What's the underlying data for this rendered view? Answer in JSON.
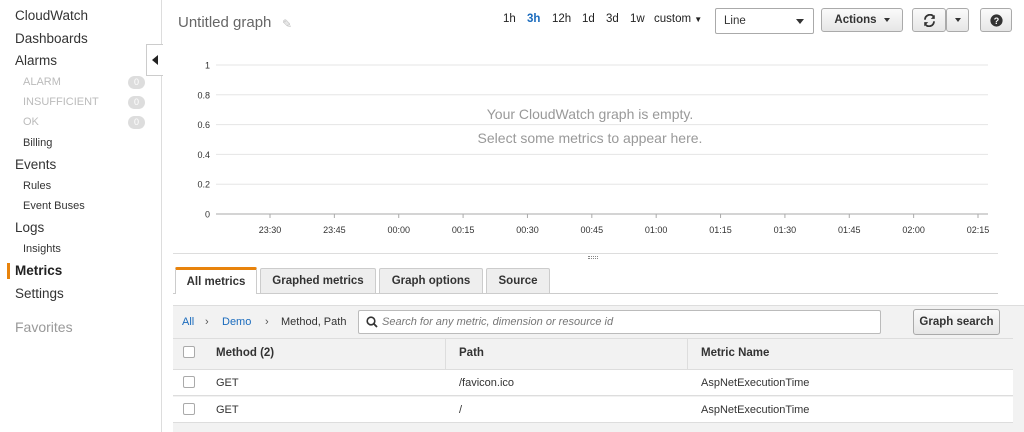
{
  "sidebar": {
    "items": [
      {
        "label": "CloudWatch"
      },
      {
        "label": "Dashboards"
      },
      {
        "label": "Alarms"
      },
      {
        "label": "ALARM",
        "badge": "0"
      },
      {
        "label": "INSUFFICIENT",
        "badge": "0"
      },
      {
        "label": "OK",
        "badge": "0"
      },
      {
        "label": "Billing"
      },
      {
        "label": "Events"
      },
      {
        "label": "Rules"
      },
      {
        "label": "Event Buses"
      },
      {
        "label": "Logs"
      },
      {
        "label": "Insights"
      },
      {
        "label": "Metrics"
      },
      {
        "label": "Settings"
      }
    ],
    "favorites": "Favorites",
    "active_item": "Metrics"
  },
  "header": {
    "title": "Untitled graph",
    "time_ranges": [
      "1h",
      "3h",
      "12h",
      "1d",
      "3d",
      "1w",
      "custom"
    ],
    "active_range": "3h",
    "chart_type_select": "Line",
    "actions_label": "Actions"
  },
  "chart_data": {
    "type": "line",
    "x_tick_labels": [
      "23:30",
      "23:45",
      "00:00",
      "00:15",
      "00:30",
      "00:45",
      "01:00",
      "01:15",
      "01:30",
      "01:45",
      "02:00",
      "02:15"
    ],
    "y_tick_labels": [
      "1",
      "0.8",
      "0.6",
      "0.4",
      "0.2",
      "0"
    ],
    "ylim": [
      0,
      1
    ],
    "series": [],
    "grid": true
  },
  "empty_message": {
    "line1": "Your CloudWatch graph is empty.",
    "line2": "Select some metrics to appear here."
  },
  "tabs": [
    {
      "label": "All metrics"
    },
    {
      "label": "Graphed metrics"
    },
    {
      "label": "Graph options"
    },
    {
      "label": "Source"
    }
  ],
  "active_tab": "All metrics",
  "breadcrumb": {
    "all": "All",
    "namespace": "Demo",
    "dimension": "Method, Path"
  },
  "search": {
    "placeholder": "Search for any metric, dimension or resource id",
    "value": "",
    "button_label": "Graph search"
  },
  "table": {
    "columns": [
      "Method (2)",
      "Path",
      "Metric Name"
    ],
    "rows": [
      {
        "method": "GET",
        "path": "/favicon.ico",
        "metric": "AspNetExecutionTime"
      },
      {
        "method": "GET",
        "path": "/",
        "metric": "AspNetExecutionTime"
      }
    ]
  },
  "colors": {
    "accent": "#e8830c",
    "link": "#1a6bbd"
  },
  "icons": [
    "pencil-icon",
    "refresh-icon",
    "help-icon",
    "search-icon",
    "collapse-arrow-icon"
  ]
}
